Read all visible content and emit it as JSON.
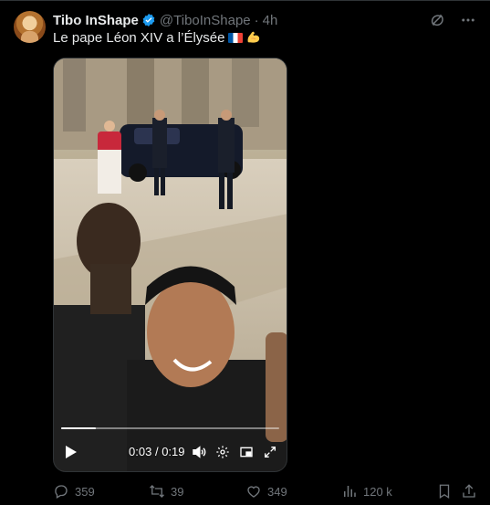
{
  "tweet": {
    "display_name": "Tibo InShape",
    "handle": "@TiboInShape",
    "separator": "·",
    "time": "4h",
    "text": "Le pape Léon XIV a l’Élysée",
    "emojis": [
      "french-flag",
      "flexed-biceps"
    ]
  },
  "video": {
    "current_time": "0:03",
    "duration": "0:19",
    "time_separator": "/",
    "progress_fraction": 0.16
  },
  "actions": {
    "replies": "359",
    "reposts": "39",
    "likes": "349",
    "views": "120 k"
  },
  "icons": {
    "verified": "verified-badge-icon",
    "grok": "grok-icon",
    "more": "more-icon",
    "play": "play-icon",
    "volume": "volume-icon",
    "settings": "settings-icon",
    "pip": "picture-in-picture-icon",
    "fullscreen": "fullscreen-icon",
    "reply": "reply-icon",
    "repost": "repost-icon",
    "like": "like-icon",
    "views": "views-icon",
    "bookmark": "bookmark-icon",
    "share": "share-icon"
  },
  "colors": {
    "background": "#000000",
    "text": "#e7e9ea",
    "muted": "#71767b",
    "verified": "#1d9bf0",
    "border": "#2f3336"
  }
}
